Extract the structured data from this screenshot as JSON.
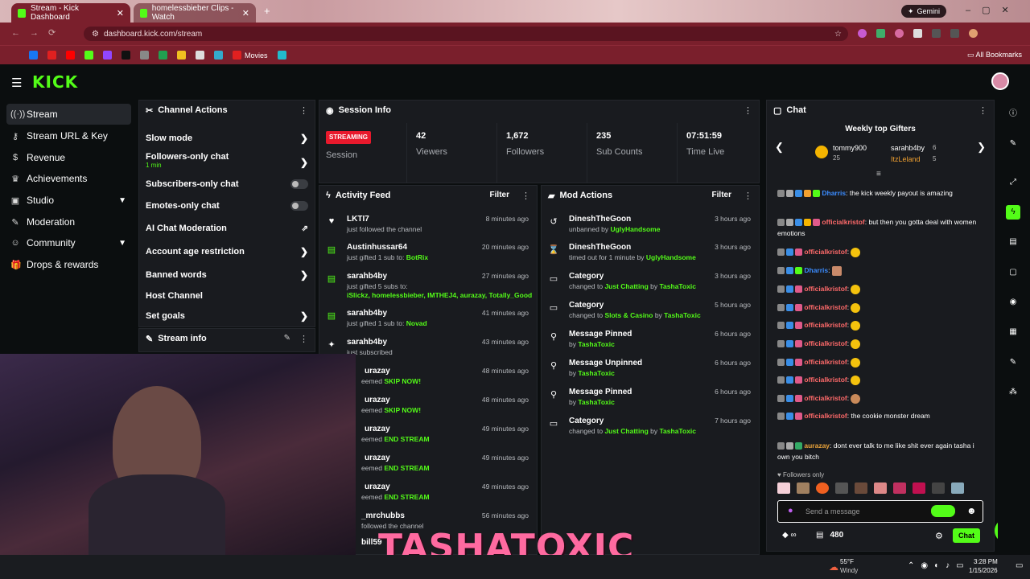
{
  "browser": {
    "tabs": [
      {
        "label": "Stream - Kick Dashboard"
      },
      {
        "label": "homelessbieber Clips - Watch"
      }
    ],
    "url": "dashboard.kick.com/stream",
    "profile_label": "Gemini",
    "bookmarks": [
      "Movies"
    ],
    "all_bookmarks": "All Bookmarks"
  },
  "app": {
    "logo": "KICK"
  },
  "nav": {
    "items": [
      {
        "label": "Stream",
        "icon": "broadcast-icon"
      },
      {
        "label": "Stream URL & Key",
        "icon": "key-icon"
      },
      {
        "label": "Revenue",
        "icon": "dollar-icon"
      },
      {
        "label": "Achievements",
        "icon": "trophy-icon"
      },
      {
        "label": "Studio",
        "icon": "studio-icon"
      },
      {
        "label": "Moderation",
        "icon": "wrench-icon"
      },
      {
        "label": "Community",
        "icon": "people-icon"
      },
      {
        "label": "Drops & rewards",
        "icon": "gift-icon"
      }
    ]
  },
  "channel_actions": {
    "title": "Channel Actions",
    "rows": [
      {
        "label": "Slow mode"
      },
      {
        "label": "Followers-only chat",
        "sub": "1 min"
      },
      {
        "label": "Subscribers-only chat"
      },
      {
        "label": "Emotes-only chat"
      },
      {
        "label": "AI Chat Moderation"
      },
      {
        "label": "Account age restriction"
      },
      {
        "label": "Banned words"
      },
      {
        "label": "Host Channel"
      },
      {
        "label": "Set goals"
      }
    ],
    "stream_info": "Stream info"
  },
  "session": {
    "title": "Session Info",
    "status": "STREAMING",
    "status_label": "Session",
    "stats": [
      {
        "value": "42",
        "label": "Viewers"
      },
      {
        "value": "1,672",
        "label": "Followers"
      },
      {
        "value": "235",
        "label": "Sub Counts"
      },
      {
        "value": "07:51:59",
        "label": "Time Live"
      }
    ]
  },
  "activity": {
    "title": "Activity Feed",
    "filter": "Filter",
    "items": [
      {
        "user": "LKTI7",
        "text": "just followed the channel",
        "time": "8 minutes ago"
      },
      {
        "user": "Austinhussar64",
        "text": "just gifted 1 sub to:",
        "extra": "BotRix",
        "time": "20 minutes ago"
      },
      {
        "user": "sarahb4by",
        "text": "just gifted 5 subs to:",
        "extra": "iSlickz, homelessbieber, IMTHEJ4, aurazay, Totally_Good",
        "time": "27 minutes ago"
      },
      {
        "user": "sarahb4by",
        "text": "just gifted 1 sub to:",
        "extra": "Novad",
        "time": "41 minutes ago"
      },
      {
        "user": "sarahb4by",
        "text": "just subscribed",
        "time": "43 minutes ago"
      },
      {
        "user": "urazay",
        "text": "eemed",
        "extra": "SKIP NOW!",
        "time": "48 minutes ago"
      },
      {
        "user": "urazay",
        "text": "eemed",
        "extra": "SKIP NOW!",
        "time": "48 minutes ago"
      },
      {
        "user": "urazay",
        "text": "eemed",
        "extra": "END STREAM",
        "time": "49 minutes ago"
      },
      {
        "user": "urazay",
        "text": "eemed",
        "extra": "END STREAM",
        "time": "49 minutes ago"
      },
      {
        "user": "urazay",
        "text": "eemed",
        "extra": "END STREAM",
        "time": "49 minutes ago"
      },
      {
        "user": "_mrchubbs",
        "text": "followed the channel",
        "time": "56 minutes ago"
      },
      {
        "user": "bill59",
        "text": "",
        "time": ""
      }
    ]
  },
  "mod": {
    "title": "Mod Actions",
    "filter": "Filter",
    "items": [
      {
        "title": "DineshTheGoon",
        "pre": "unbanned by",
        "who": "UglyHandsome",
        "time": "3 hours ago",
        "icon": "unban-icon"
      },
      {
        "title": "DineshTheGoon",
        "pre": "timed out for 1 minute by",
        "who": "UglyHandsome",
        "time": "3 hours ago",
        "icon": "hourglass-icon"
      },
      {
        "title": "Category",
        "pre": "changed to",
        "who": "Just Chatting",
        "post": "by",
        "who2": "TashaToxic",
        "time": "3 hours ago",
        "icon": "category-icon"
      },
      {
        "title": "Category",
        "pre": "changed to",
        "who": "Slots & Casino",
        "post": "by",
        "who2": "TashaToxic",
        "time": "5 hours ago",
        "icon": "category-icon"
      },
      {
        "title": "Message Pinned",
        "pre": "by",
        "who": "TashaToxic",
        "time": "6 hours ago",
        "icon": "pin-icon"
      },
      {
        "title": "Message Unpinned",
        "pre": "by",
        "who": "TashaToxic",
        "time": "6 hours ago",
        "icon": "unpin-icon"
      },
      {
        "title": "Message Pinned",
        "pre": "by",
        "who": "TashaToxic",
        "time": "6 hours ago",
        "icon": "pin-icon"
      },
      {
        "title": "Category",
        "pre": "changed to",
        "who": "Just Chatting",
        "post": "by",
        "who2": "TashaToxic",
        "time": "7 hours ago",
        "icon": "category-icon"
      }
    ]
  },
  "chat": {
    "title": "Chat",
    "gifters_title": "Weekly top Gifters",
    "gifters": [
      {
        "name": "tommy900",
        "count": "25"
      },
      {
        "name": "sarahb4by",
        "count": "6"
      },
      {
        "name": "ItzLeland",
        "count": "5"
      }
    ],
    "messages": [
      {
        "user": "Dharris",
        "color": "#3b8cff",
        "text": "the kick weekly payout is amazing"
      },
      {
        "user": "officialkristof",
        "color": "#ff6a6a",
        "text": "but then you gotta deal with women emotions"
      },
      {
        "user": "officialkristof",
        "color": "#ff6a6a",
        "text": ""
      },
      {
        "user": "Dharris",
        "color": "#3b8cff",
        "text": ""
      },
      {
        "user": "officialkristof",
        "color": "#ff6a6a",
        "text": ""
      },
      {
        "user": "officialkristof",
        "color": "#ff6a6a",
        "text": ""
      },
      {
        "user": "officialkristof",
        "color": "#ff6a6a",
        "text": ""
      },
      {
        "user": "officialkristof",
        "color": "#ff6a6a",
        "text": ""
      },
      {
        "user": "officialkristof",
        "color": "#ff6a6a",
        "text": ""
      },
      {
        "user": "officialkristof",
        "color": "#ff6a6a",
        "text": ""
      },
      {
        "user": "officialkristof",
        "color": "#ff6a6a",
        "text": ""
      },
      {
        "user": "officialkristof",
        "color": "#ff6a6a",
        "text": "the cookie monster dream"
      },
      {
        "user": "aurazay",
        "color": "#e8a23a",
        "text": "dont ever talk to me like shit ever again tasha i own you bitch"
      }
    ],
    "followers_only": "Followers only",
    "placeholder": "Send a message",
    "points": "480",
    "send": "Chat"
  },
  "overlay": {
    "name": "TASHATOXIC"
  },
  "taskbar": {
    "weather_temp": "55°F",
    "weather_desc": "Windy",
    "time": "3:28 PM",
    "date": "1/15/2026"
  }
}
